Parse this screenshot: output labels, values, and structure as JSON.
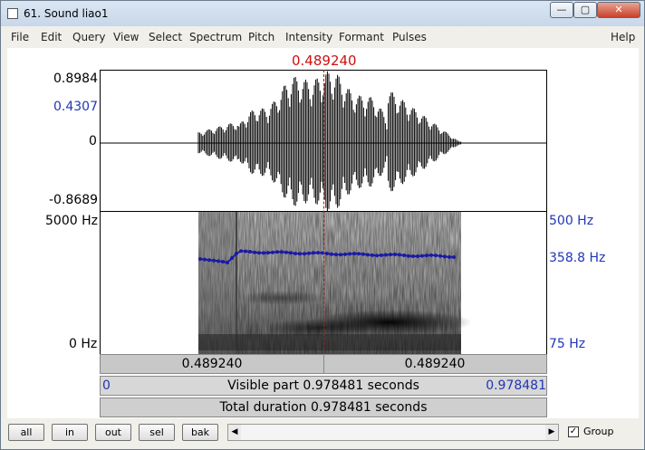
{
  "window": {
    "title": "61. Sound liao1"
  },
  "menu": [
    "File",
    "Edit",
    "Query",
    "View",
    "Select",
    "Spectrum",
    "Pitch",
    "Intensity",
    "Formant",
    "Pulses"
  ],
  "help_label": "Help",
  "cursor_label": "0.489240",
  "wave_axis": {
    "max": "0.8984",
    "mid": "0.4307",
    "zero": "0",
    "min": "-0.8689"
  },
  "spec_axis": {
    "top": "5000 Hz",
    "bottom": "0 Hz"
  },
  "pitch_axis": {
    "top": "500 Hz",
    "mid": "358.8 Hz",
    "bottom": "75 Hz"
  },
  "colors": {
    "accent_red": "#d01010",
    "pitch_blue": "#1a1aa8",
    "axis_blue": "#1f36b5"
  },
  "bars": {
    "sel_left": "0.489240",
    "sel_right": "0.489240",
    "visible_start": "0",
    "visible_label": "Visible part 0.978481 seconds",
    "visible_end": "0.978481",
    "total_label": "Total duration 0.978481 seconds"
  },
  "buttons": [
    "all",
    "in",
    "out",
    "sel",
    "bak"
  ],
  "group": {
    "label": "Group",
    "checked": true
  }
}
